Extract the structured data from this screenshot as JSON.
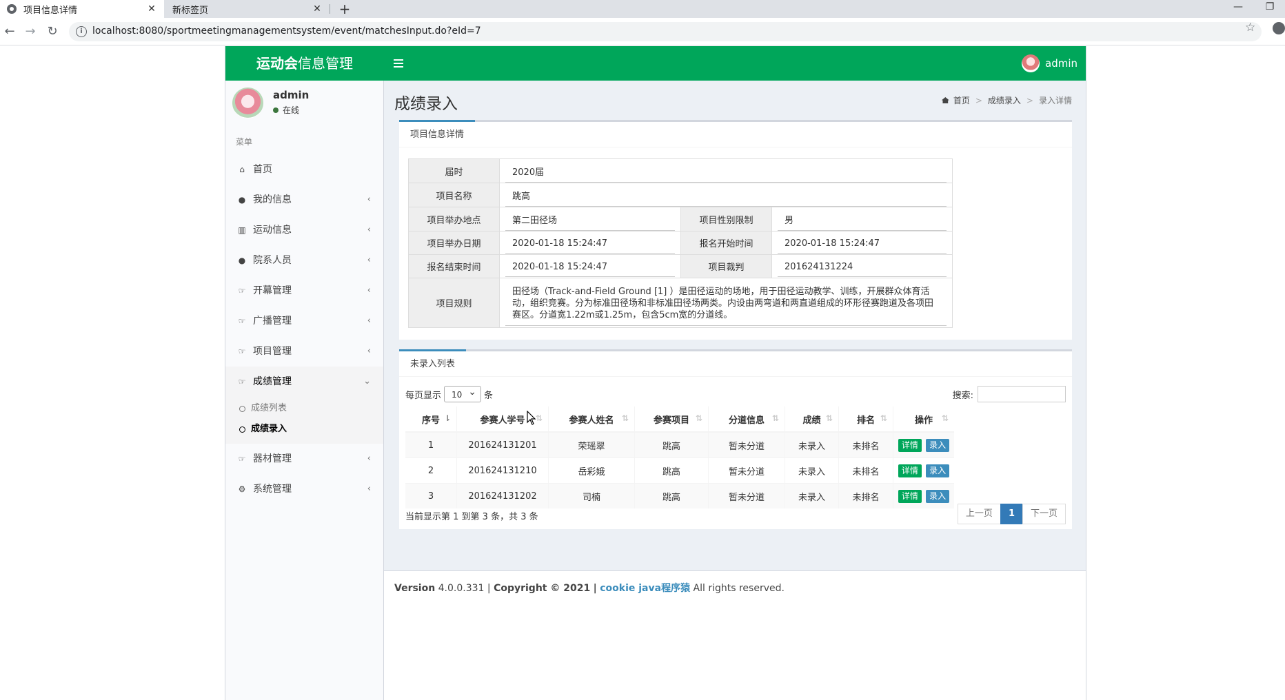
{
  "browser": {
    "active_tab": "项目信息详情",
    "inactive_tab": "新标签页",
    "url": "localhost:8080/sportmeetingmanagementsystem/event/matchesInput.do?eId=7",
    "tab_close": "✕",
    "new_tab": "+",
    "min": "—",
    "restore": "❐"
  },
  "app": {
    "logo_bold": "运动会",
    "logo_rest": "信息管理",
    "header_user": "admin"
  },
  "sidebar": {
    "user": "admin",
    "status": "在线",
    "menu_header": "菜单",
    "items": [
      {
        "label": "首页",
        "icon": "home-icon"
      },
      {
        "label": "我的信息",
        "icon": "user-icon"
      },
      {
        "label": "运动信息",
        "icon": "bar-chart-icon"
      },
      {
        "label": "院系人员",
        "icon": "users-icon"
      },
      {
        "label": "开幕管理",
        "icon": "thumbs-up-icon"
      },
      {
        "label": "广播管理",
        "icon": "thumbs-up-icon"
      },
      {
        "label": "项目管理",
        "icon": "thumbs-up-icon"
      },
      {
        "label": "成绩管理",
        "icon": "thumbs-up-icon"
      },
      {
        "label": "器材管理",
        "icon": "thumbs-up-icon"
      },
      {
        "label": "系统管理",
        "icon": "gear-icon"
      }
    ],
    "sub_items": [
      "成绩列表",
      "成绩录入"
    ]
  },
  "page": {
    "title": "成绩录入",
    "breadcrumb": [
      "首页",
      "成绩录入",
      "录入详情"
    ],
    "breadcrumb_sep": ">"
  },
  "detail": {
    "tab": "项目信息详情",
    "session_label": "届时",
    "session": "2020届",
    "name_label": "项目名称",
    "name": "跳高",
    "place_label": "项目举办地点",
    "place": "第二田径场",
    "gender_label": "项目性别限制",
    "gender": "男",
    "date_label": "项目举办日期",
    "date": "2020-01-18 15:24:47",
    "reg_start_label": "报名开始时间",
    "reg_start": "2020-01-18 15:24:47",
    "reg_end_label": "报名结束时间",
    "reg_end": "2020-01-18 15:24:47",
    "judge_label": "项目裁判",
    "judge": "201624131224",
    "rule_label": "项目规则",
    "rule": "田径场（Track-and-Field Ground [1] ）是田径运动的场地，用于田径运动教学、训练，开展群众体育活动，组织竞赛。分为标准田径场和非标准田径场两类。内设由两弯道和两直道组成的环形径赛跑道及各项田赛区。分道宽1.22m或1.25m，包含5cm宽的分道线。"
  },
  "list": {
    "tab": "未录入列表",
    "length_prefix": "每页显示",
    "length_value": "10",
    "length_suffix": "条",
    "search_label": "搜索:",
    "search_value": "",
    "headers": [
      "序号",
      "参赛人学号",
      "参赛人姓名",
      "参赛项目",
      "分道信息",
      "成绩",
      "排名",
      "操作"
    ],
    "sort_first": "⇂",
    "sort_other": "⇅",
    "rows": [
      {
        "no": "1",
        "sid": "201624131201",
        "sname": "荣瑶翠",
        "event": "跳高",
        "lane": "暂未分道",
        "score": "未录入",
        "rank": "未排名"
      },
      {
        "no": "2",
        "sid": "201624131210",
        "sname": "岳彩娥",
        "event": "跳高",
        "lane": "暂未分道",
        "score": "未录入",
        "rank": "未排名"
      },
      {
        "no": "3",
        "sid": "201624131202",
        "sname": "司楠",
        "event": "跳高",
        "lane": "暂未分道",
        "score": "未录入",
        "rank": "未排名"
      }
    ],
    "btn_detail": "详情",
    "btn_input": "录入",
    "info": "当前显示第 1 到第 3 条，共 3 条",
    "prev": "上一页",
    "page": "1",
    "next": "下一页"
  },
  "footer": {
    "version_label": "Version",
    "version": "4.0.0.331",
    "sep": "|",
    "copyright": "Copyright © 2021",
    "link": "cookie java程序猿",
    "rights": "All rights reserved."
  },
  "colors": {
    "header_green": "#00a65a",
    "tab_blue": "#3c8dbc",
    "pager_blue": "#337ab7"
  }
}
